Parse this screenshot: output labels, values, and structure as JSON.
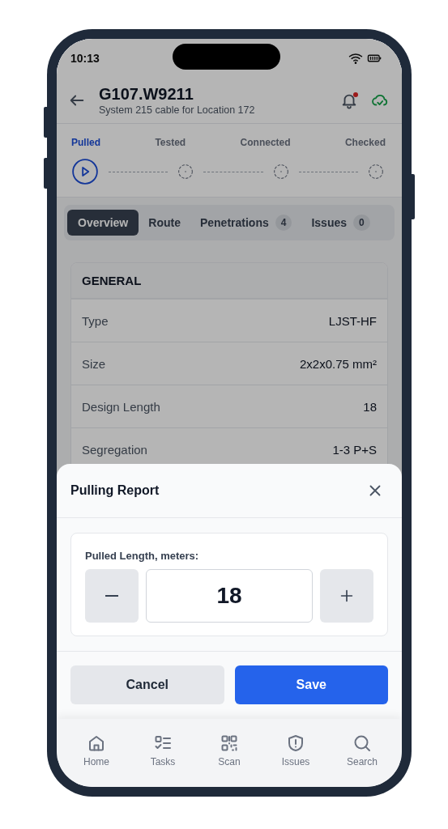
{
  "status_bar": {
    "time": "10:13"
  },
  "header": {
    "title": "G107.W9211",
    "subtitle": "System 215 cable for Location 172",
    "notification_unread": true,
    "synced": true
  },
  "stepper": [
    {
      "label": "Pulled",
      "selected": true
    },
    {
      "label": "Tested",
      "selected": false
    },
    {
      "label": "Connected",
      "selected": false
    },
    {
      "label": "Checked",
      "selected": false
    }
  ],
  "tabs": [
    {
      "label": "Overview",
      "selected": true
    },
    {
      "label": "Route",
      "selected": false
    },
    {
      "label": "Penetrations",
      "count": "4",
      "selected": false
    },
    {
      "label": "Issues",
      "count": "0",
      "selected": false
    }
  ],
  "general": {
    "title": "GENERAL",
    "rows": [
      {
        "label": "Type",
        "value": "LJST-HF"
      },
      {
        "label": "Size",
        "value": "2x2x0.75 mm²"
      },
      {
        "label": "Design Length",
        "value": "18"
      },
      {
        "label": "Segregation",
        "value": "1-3 P+S"
      }
    ]
  },
  "pulling_report": {
    "title": "Pulling Report",
    "field_label": "Pulled Length, meters:",
    "value": "18",
    "buttons": [
      {
        "label": "Cancel",
        "kind": "secondary"
      },
      {
        "label": "Save",
        "kind": "primary"
      }
    ]
  },
  "nav": [
    {
      "label": "Home",
      "kind": "home"
    },
    {
      "label": "Tasks",
      "kind": "tasks"
    },
    {
      "label": "Scan",
      "kind": "scan"
    },
    {
      "label": "Issues",
      "kind": "issues"
    },
    {
      "label": "Search",
      "kind": "search"
    }
  ]
}
